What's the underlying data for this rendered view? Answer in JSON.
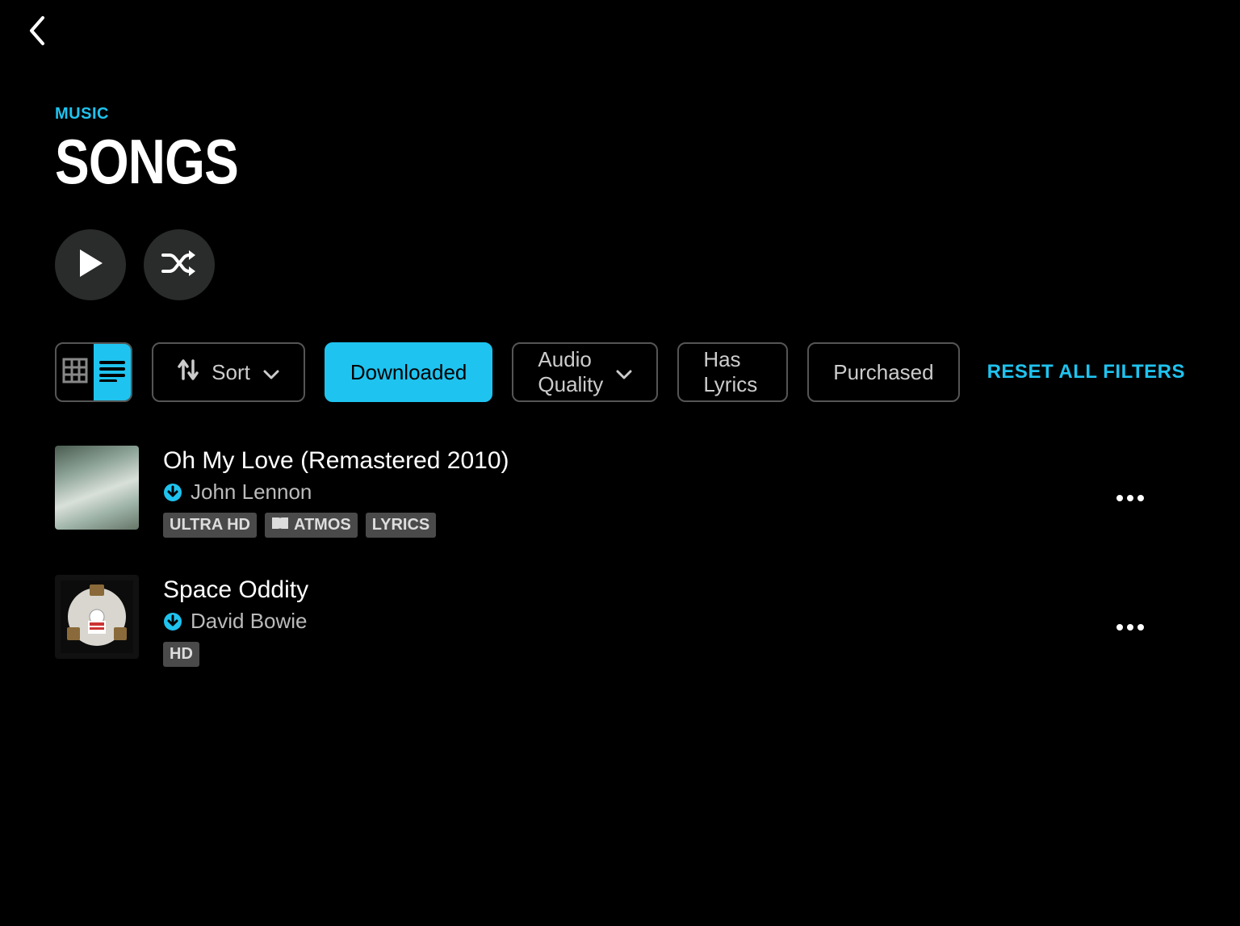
{
  "nav": {
    "back_label": "Back"
  },
  "header": {
    "breadcrumb": "MUSIC",
    "title": "SONGS"
  },
  "actions": {
    "play_label": "Play all",
    "shuffle_label": "Shuffle"
  },
  "toolbar": {
    "view_grid_label": "Grid view",
    "view_list_label": "List view",
    "sort_label": "Sort",
    "downloaded_label": "Downloaded",
    "audio_quality_label": "Audio Quality",
    "has_lyrics_label": "Has Lyrics",
    "purchased_label": "Purchased",
    "reset_label": "RESET ALL FILTERS",
    "active_filter": "downloaded",
    "active_view": "list"
  },
  "songs": [
    {
      "title": "Oh My Love (Remastered 2010)",
      "artist": "John Lennon",
      "downloaded": true,
      "badges": [
        "ULTRA HD",
        "ATMOS",
        "LYRICS"
      ]
    },
    {
      "title": "Space Oddity",
      "artist": "David Bowie",
      "downloaded": true,
      "badges": [
        "HD"
      ]
    }
  ],
  "badge_labels": {
    "ultra_hd": "ULTRA HD",
    "atmos": "ATMOS",
    "lyrics": "LYRICS",
    "hd": "HD"
  },
  "colors": {
    "accent": "#1fc3ef",
    "bg": "#000000",
    "badge_bg": "#4a4a4a"
  }
}
